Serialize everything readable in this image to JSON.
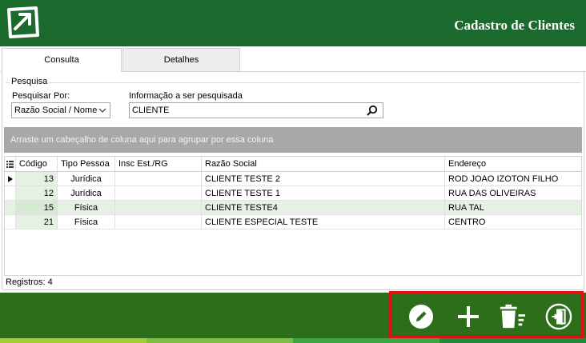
{
  "app": {
    "title": "Cadastro de Clientes"
  },
  "tabs": [
    {
      "label": "Consulta"
    },
    {
      "label": "Detalhes"
    }
  ],
  "search": {
    "group_title": "Pesquisa",
    "search_by_label": "Pesquisar Por:",
    "search_by_value": "Razão Social / Nome",
    "info_label": "Informação a ser pesquisada",
    "info_value": "CLIENTE"
  },
  "grid": {
    "group_hint": "Arraste um cabeçalho de coluna aqui para agrupar por essa coluna",
    "columns": [
      "Código",
      "Tipo Pessoa",
      "Insc Est./RG",
      "Razão Social",
      "Endereço"
    ],
    "rows": [
      {
        "codigo": "13",
        "tipo": "Jurídica",
        "insc": "",
        "razao": "CLIENTE TESTE 2",
        "endereco": "ROD JOAO IZOTON FILHO"
      },
      {
        "codigo": "12",
        "tipo": "Jurídica",
        "insc": "",
        "razao": "CLIENTE TESTE 1",
        "endereco": "RUA DAS OLIVEIRAS"
      },
      {
        "codigo": "15",
        "tipo": "Física",
        "insc": "",
        "razao": "CLIENTE TESTE4",
        "endereco": "RUA TAL"
      },
      {
        "codigo": "21",
        "tipo": "Física",
        "insc": "",
        "razao": "CLIENTE ESPECIAL TESTE",
        "endereco": "CENTRO"
      }
    ],
    "records_label": "Registros: 4"
  },
  "toolbar": {
    "icons": [
      "pencil-icon",
      "plus-icon",
      "trash-icon",
      "exit-door-icon"
    ]
  },
  "colors": {
    "header": "#1a6a2e",
    "bottom_bar": "#2d6e1b",
    "alt_row": "#e5f2e3",
    "highlight": "#e01010"
  }
}
